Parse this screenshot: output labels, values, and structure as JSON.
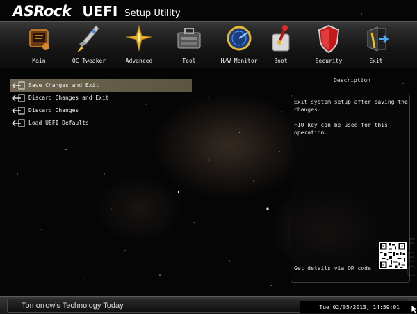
{
  "header": {
    "brand": "ASRock",
    "uefi": "UEFI",
    "subtitle": "Setup Utility"
  },
  "nav": {
    "items": [
      {
        "label": "Main",
        "icon": "main-icon"
      },
      {
        "label": "OC Tweaker",
        "icon": "rocket-icon"
      },
      {
        "label": "Advanced",
        "icon": "star-icon"
      },
      {
        "label": "Tool",
        "icon": "toolbox-icon"
      },
      {
        "label": "H/W Monitor",
        "icon": "radar-icon"
      },
      {
        "label": "Boot",
        "icon": "boot-switch-icon"
      },
      {
        "label": "Security",
        "icon": "shield-icon"
      },
      {
        "label": "Exit",
        "icon": "exit-icon"
      }
    ],
    "active": "Exit"
  },
  "menu": {
    "items": [
      {
        "label": "Save Changes and Exit",
        "selected": true
      },
      {
        "label": "Discard Changes and Exit",
        "selected": false
      },
      {
        "label": "Discard Changes",
        "selected": false
      },
      {
        "label": "Load UEFI Defaults",
        "selected": false
      }
    ]
  },
  "description": {
    "title": "Description",
    "text": "Exit system setup after saving the changes.\n\nF10 key can be used for this operation.",
    "qr_label": "Get details via QR code"
  },
  "footer": {
    "tagline": "Tomorrow's Technology Today",
    "datetime": "Tue 02/05/2013, 14:59:01"
  },
  "colors": {
    "selection": "#6e6650",
    "navbar": "#2a2a2a",
    "background": "#050505"
  }
}
